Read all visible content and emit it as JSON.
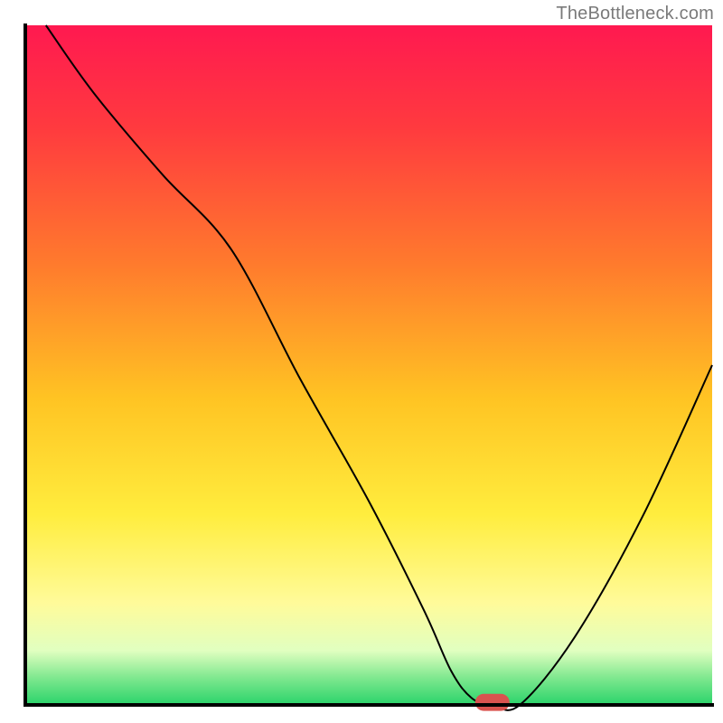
{
  "watermark": "TheBottleneck.com",
  "chart_data": {
    "type": "line",
    "title": "",
    "xlabel": "",
    "ylabel": "",
    "xlim": [
      0,
      100
    ],
    "ylim": [
      0,
      100
    ],
    "x": [
      3,
      10,
      20,
      30,
      40,
      50,
      58,
      62,
      65,
      68,
      72,
      80,
      90,
      100
    ],
    "values": [
      100,
      90,
      78,
      67,
      48,
      30,
      14,
      5,
      1,
      0,
      0,
      10,
      28,
      50
    ],
    "marker": {
      "x": 68,
      "y": 0,
      "color": "#d9534f",
      "width": 5,
      "height": 2.5,
      "shape": "pill"
    },
    "gradient_stops": [
      {
        "offset": 0,
        "color": "#ff1950"
      },
      {
        "offset": 15,
        "color": "#ff3a3f"
      },
      {
        "offset": 35,
        "color": "#ff7a2d"
      },
      {
        "offset": 55,
        "color": "#ffc423"
      },
      {
        "offset": 72,
        "color": "#ffed3e"
      },
      {
        "offset": 85,
        "color": "#fffb9a"
      },
      {
        "offset": 92,
        "color": "#e1ffc0"
      },
      {
        "offset": 96,
        "color": "#7fe88f"
      },
      {
        "offset": 100,
        "color": "#2ad36a"
      }
    ],
    "axes": {
      "color": "#000000",
      "thickness": 4
    }
  }
}
